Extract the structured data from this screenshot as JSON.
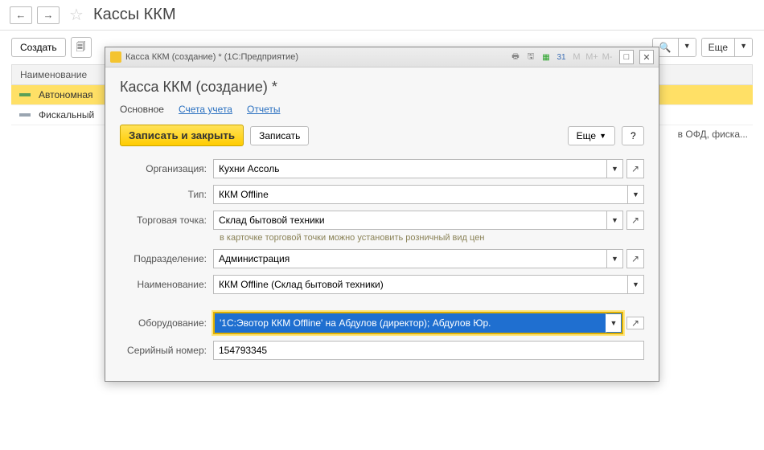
{
  "page": {
    "title": "Кассы ККМ"
  },
  "toolbar": {
    "create": "Создать",
    "more": "Еще"
  },
  "list": {
    "header": "Наименование",
    "rows": [
      {
        "label": "Автономная",
        "selected": true
      },
      {
        "label": "Фискальный",
        "selected": false
      }
    ],
    "bg_extra": "в ОФД, фиска..."
  },
  "modal": {
    "title": "Касса ККМ (создание) *  (1С:Предприятие)",
    "heading": "Касса ККМ (создание) *",
    "tabs": {
      "main": "Основное",
      "accounts": "Счета учета",
      "reports": "Отчеты"
    },
    "actions": {
      "saveclose": "Записать и закрыть",
      "save": "Записать",
      "more": "Еще",
      "help": "?"
    },
    "toolbar_marks": {
      "m1": "M",
      "m2": "M+",
      "m3": "M-"
    },
    "fields": {
      "org_label": "Организация:",
      "org_value": "Кухни Ассоль",
      "type_label": "Тип:",
      "type_value": "ККМ Offline",
      "point_label": "Торговая точка:",
      "point_value": "Склад бытовой техники",
      "point_hint": "в карточке торговой точки можно установить розничный вид цен",
      "dept_label": "Подразделение:",
      "dept_value": "Администрация",
      "name_label": "Наименование:",
      "name_value": "ККМ Offline (Склад бытовой техники)",
      "equip_label": "Оборудование:",
      "equip_value": "'1С:Эвотор ККМ Offline' на Абдулов (директор); Абдулов Юр.",
      "serial_label": "Серийный номер:",
      "serial_value": "154793345"
    }
  }
}
